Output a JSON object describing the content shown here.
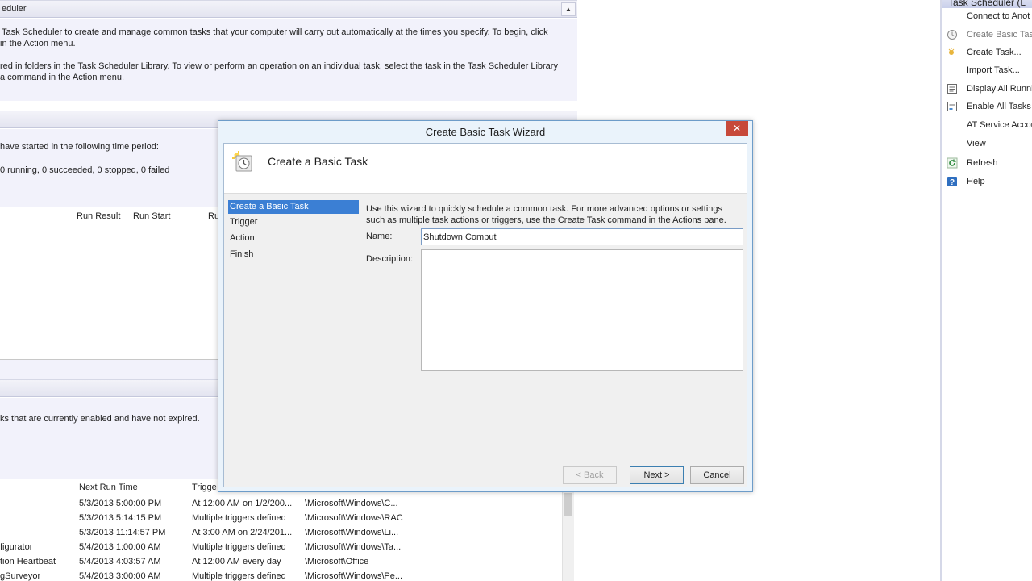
{
  "background": {
    "overview_header": "eduler",
    "overview_lines": [
      "Task Scheduler to create and manage common tasks that your computer will carry out automatically at the times you specify. To begin, click",
      "in the Action menu.",
      "red in folders in the Task Scheduler Library. To view or perform an operation on an individual task, select the task in the Task Scheduler Library",
      "a command in the Action menu."
    ],
    "status_lines": [
      "have started in the following time period:",
      "0 running, 0 succeeded, 0 stopped, 0 failed"
    ],
    "status_columns": [
      "Run Result",
      "Run Start",
      "Ru"
    ],
    "active_line": "ks that are currently enabled and have not expired.",
    "active_columns": [
      "Next Run Time",
      "Trigge"
    ],
    "active_rows": [
      {
        "name": "",
        "next": "5/3/2013 5:00:00 PM",
        "trigger": "At 12:00 AM on 1/2/200...",
        "location": "\\Microsoft\\Windows\\C..."
      },
      {
        "name": "",
        "next": "5/3/2013 5:14:15 PM",
        "trigger": "Multiple triggers defined",
        "location": "\\Microsoft\\Windows\\RAC"
      },
      {
        "name": "",
        "next": "5/3/2013 11:14:57 PM",
        "trigger": "At 3:00 AM on 2/24/201...",
        "location": "\\Microsoft\\Windows\\Li..."
      },
      {
        "name": "figurator",
        "next": "5/4/2013 1:00:00 AM",
        "trigger": "Multiple triggers defined",
        "location": "\\Microsoft\\Windows\\Ta..."
      },
      {
        "name": "tion Heartbeat",
        "next": "5/4/2013 4:03:57 AM",
        "trigger": "At 12:00 AM every day",
        "location": "\\Microsoft\\Office"
      },
      {
        "name": "gSurveyor",
        "next": "5/4/2013 3:00:00 AM",
        "trigger": "Multiple triggers defined",
        "location": "\\Microsoft\\Windows\\Pe..."
      }
    ]
  },
  "actions": {
    "header": "Task Scheduler (L",
    "items": [
      {
        "label": "Connect to Anot",
        "icon": "none",
        "dim": false
      },
      {
        "label": "Create Basic Task",
        "icon": "create-basic-task-icon",
        "dim": true
      },
      {
        "label": "Create Task...",
        "icon": "create-task-icon",
        "dim": false
      },
      {
        "label": "Import Task...",
        "icon": "none",
        "dim": false
      },
      {
        "label": "Display All Runni",
        "icon": "display-running-icon",
        "dim": false
      },
      {
        "label": "Enable All Tasks I",
        "icon": "enable-history-icon",
        "dim": false
      },
      {
        "label": "AT Service Accou",
        "icon": "none",
        "dim": false
      },
      {
        "label": "View",
        "icon": "none",
        "dim": false
      },
      {
        "label": "Refresh",
        "icon": "refresh-icon",
        "dim": false
      },
      {
        "label": "Help",
        "icon": "help-icon",
        "dim": false
      }
    ]
  },
  "dialog": {
    "title": "Create Basic Task Wizard",
    "close_glyph": "✕",
    "heading": "Create a Basic Task",
    "steps": [
      "Create a Basic Task",
      "Trigger",
      "Action",
      "Finish"
    ],
    "active_step": 0,
    "intro_line1": "Use this wizard to quickly schedule a common task.  For more advanced options or settings",
    "intro_line2": "such as multiple task actions or triggers, use the Create Task command in the Actions pane.",
    "name_label": "Name:",
    "name_value": "Shutdown Comput",
    "description_label": "Description:",
    "description_value": "",
    "back_label": "< Back",
    "next_label": "Next >",
    "cancel_label": "Cancel"
  },
  "colors": {
    "accent": "#3b7fd4",
    "close_button": "#c7493a",
    "section_header": "#e3e4f0"
  }
}
